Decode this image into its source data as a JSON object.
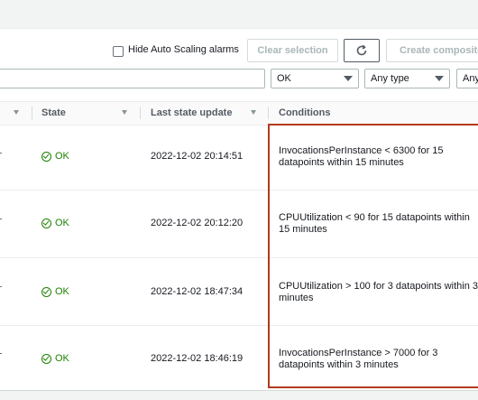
{
  "toolbar": {
    "hide_autoscaling_label": "Hide Auto Scaling alarms",
    "clear_selection_label": "Clear selection",
    "refresh_icon": "refresh-icon",
    "create_composite_label": "Create composite"
  },
  "filters": {
    "search_value": "",
    "state_value": "OK",
    "type_value": "Any type",
    "more_value": "Any"
  },
  "table": {
    "columns": [
      "State",
      "Last state update",
      "Conditions"
    ],
    "rows": [
      {
        "state": "OK",
        "updated": "2022-12-02 20:14:51",
        "conditions": "InvocationsPerInstance < 6300 for 15 datapoints within 15 minutes"
      },
      {
        "state": "OK",
        "updated": "2022-12-02 20:12:20",
        "conditions": "CPUUtilization < 90 for 15 datapoints within 15 minutes"
      },
      {
        "state": "OK",
        "updated": "2022-12-02 18:47:34",
        "conditions": "CPUUtilization > 100 for 3 datapoints within 3 minutes"
      },
      {
        "state": "OK",
        "updated": "2022-12-02 18:46:19",
        "conditions": "InvocationsPerInstance > 7000 for 3 datapoints within 3 minutes"
      }
    ]
  },
  "colors": {
    "ok_green": "#1d8102",
    "highlight_red": "#b33a1e"
  }
}
